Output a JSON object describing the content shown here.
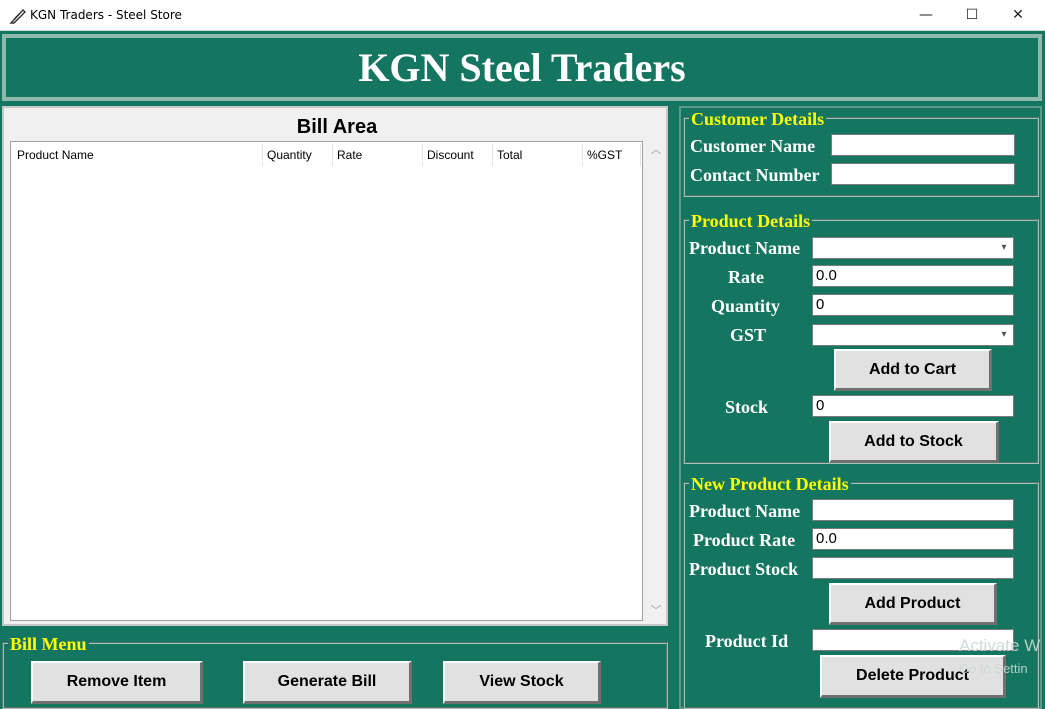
{
  "window": {
    "title": "KGN Traders - Steel Store",
    "controls": {
      "minimize": "—",
      "maximize": "☐",
      "close": "✕"
    }
  },
  "header": {
    "title": "KGN Steel Traders"
  },
  "bill": {
    "title": "Bill Area",
    "columns": [
      "Product Name",
      "Quantity",
      "Rate",
      "Discount",
      "Total",
      "%GST"
    ]
  },
  "customer": {
    "legend": "Customer Details",
    "name_label": "Customer Name",
    "name_value": "",
    "contact_label": "Contact Number",
    "contact_value": ""
  },
  "product": {
    "legend": "Product Details",
    "name_label": "Product Name",
    "name_value": "",
    "rate_label": "Rate",
    "rate_value": "0.0",
    "quantity_label": "Quantity",
    "quantity_value": "0",
    "gst_label": "GST",
    "gst_value": "",
    "add_cart_label": "Add to Cart",
    "stock_label": "Stock",
    "stock_value": "0",
    "add_stock_label": "Add to Stock"
  },
  "new_product": {
    "legend": "New Product Details",
    "name_label": "Product Name",
    "name_value": "",
    "rate_label": "Product Rate",
    "rate_value": "0.0",
    "stock_label": "Product Stock",
    "stock_value": "",
    "add_label": "Add Product",
    "id_label": "Product Id",
    "id_value": "",
    "delete_label": "Delete Product"
  },
  "bill_menu": {
    "legend": "Bill Menu",
    "remove_label": "Remove Item",
    "generate_label": "Generate Bill",
    "view_stock_label": "View Stock"
  },
  "watermark": {
    "line1": "Activate W",
    "line2": "Go to Settin"
  },
  "colors": {
    "panel_bg": "#147560",
    "legend_text": "#ffff00",
    "label_text": "#ffffff"
  }
}
